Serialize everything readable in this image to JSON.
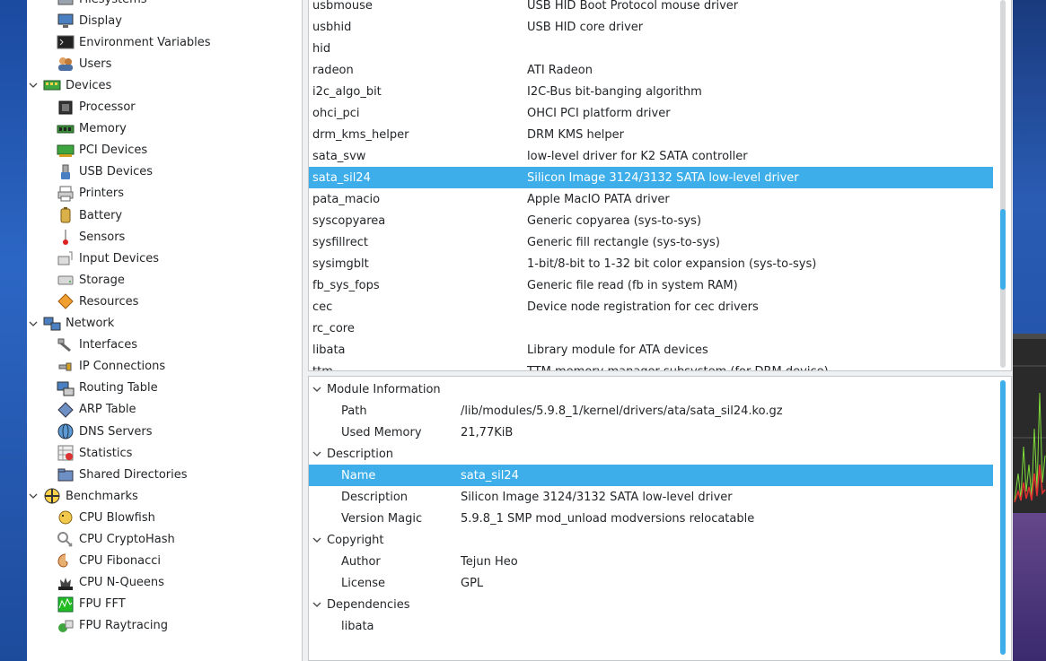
{
  "tree": {
    "items": [
      {
        "label": "Filesystems",
        "indent": 1,
        "icon": "filesystems-icon",
        "expander": ""
      },
      {
        "label": "Display",
        "indent": 1,
        "icon": "display-icon",
        "expander": ""
      },
      {
        "label": "Environment Variables",
        "indent": 1,
        "icon": "terminal-icon",
        "expander": ""
      },
      {
        "label": "Users",
        "indent": 1,
        "icon": "users-icon",
        "expander": ""
      },
      {
        "label": "Devices",
        "indent": 0,
        "icon": "devices-icon",
        "expander": "v"
      },
      {
        "label": "Processor",
        "indent": 1,
        "icon": "processor-icon",
        "expander": ""
      },
      {
        "label": "Memory",
        "indent": 1,
        "icon": "memory-icon",
        "expander": ""
      },
      {
        "label": "PCI Devices",
        "indent": 1,
        "icon": "pci-icon",
        "expander": ""
      },
      {
        "label": "USB Devices",
        "indent": 1,
        "icon": "usb-icon",
        "expander": ""
      },
      {
        "label": "Printers",
        "indent": 1,
        "icon": "printer-icon",
        "expander": ""
      },
      {
        "label": "Battery",
        "indent": 1,
        "icon": "battery-icon",
        "expander": ""
      },
      {
        "label": "Sensors",
        "indent": 1,
        "icon": "thermometer-icon",
        "expander": ""
      },
      {
        "label": "Input Devices",
        "indent": 1,
        "icon": "input-devices-icon",
        "expander": ""
      },
      {
        "label": "Storage",
        "indent": 1,
        "icon": "storage-icon",
        "expander": ""
      },
      {
        "label": "Resources",
        "indent": 1,
        "icon": "resources-icon",
        "expander": ""
      },
      {
        "label": "Network",
        "indent": 0,
        "icon": "network-icon",
        "expander": "v"
      },
      {
        "label": "Interfaces",
        "indent": 1,
        "icon": "interfaces-icon",
        "expander": ""
      },
      {
        "label": "IP Connections",
        "indent": 1,
        "icon": "ip-connections-icon",
        "expander": ""
      },
      {
        "label": "Routing Table",
        "indent": 1,
        "icon": "routing-icon",
        "expander": ""
      },
      {
        "label": "ARP Table",
        "indent": 1,
        "icon": "arp-icon",
        "expander": ""
      },
      {
        "label": "DNS Servers",
        "indent": 1,
        "icon": "dns-icon",
        "expander": ""
      },
      {
        "label": "Statistics",
        "indent": 1,
        "icon": "statistics-icon",
        "expander": ""
      },
      {
        "label": "Shared Directories",
        "indent": 1,
        "icon": "shared-dirs-icon",
        "expander": ""
      },
      {
        "label": "Benchmarks",
        "indent": 0,
        "icon": "benchmarks-icon",
        "expander": "v"
      },
      {
        "label": "CPU Blowfish",
        "indent": 1,
        "icon": "blowfish-icon",
        "expander": ""
      },
      {
        "label": "CPU CryptoHash",
        "indent": 1,
        "icon": "cryptohash-icon",
        "expander": ""
      },
      {
        "label": "CPU Fibonacci",
        "indent": 1,
        "icon": "fibonacci-icon",
        "expander": ""
      },
      {
        "label": "CPU N-Queens",
        "indent": 1,
        "icon": "nqueens-icon",
        "expander": ""
      },
      {
        "label": "FPU FFT",
        "indent": 1,
        "icon": "fft-icon",
        "expander": ""
      },
      {
        "label": "FPU Raytracing",
        "indent": 1,
        "icon": "raytracing-icon",
        "expander": ""
      }
    ]
  },
  "modules": {
    "rows": [
      {
        "name": "usbmouse",
        "desc": "USB HID Boot Protocol mouse driver"
      },
      {
        "name": "usbhid",
        "desc": "USB HID core driver"
      },
      {
        "name": "hid",
        "desc": ""
      },
      {
        "name": "radeon",
        "desc": "ATI Radeon"
      },
      {
        "name": "i2c_algo_bit",
        "desc": "I2C-Bus bit-banging algorithm"
      },
      {
        "name": "ohci_pci",
        "desc": "OHCI PCI platform driver"
      },
      {
        "name": "drm_kms_helper",
        "desc": "DRM KMS helper"
      },
      {
        "name": "sata_svw",
        "desc": "low-level driver for K2 SATA controller"
      },
      {
        "name": "sata_sil24",
        "desc": "Silicon Image 3124/3132 SATA low-level driver",
        "selected": true
      },
      {
        "name": "pata_macio",
        "desc": "Apple MacIO PATA driver"
      },
      {
        "name": "syscopyarea",
        "desc": "Generic copyarea (sys-to-sys)"
      },
      {
        "name": "sysfillrect",
        "desc": "Generic fill rectangle (sys-to-sys)"
      },
      {
        "name": "sysimgblt",
        "desc": "1-bit/8-bit to 1-32 bit color expansion (sys-to-sys)"
      },
      {
        "name": "fb_sys_fops",
        "desc": "Generic file read (fb in system RAM)"
      },
      {
        "name": "cec",
        "desc": "Device node registration for cec drivers"
      },
      {
        "name": "rc_core",
        "desc": ""
      },
      {
        "name": "libata",
        "desc": "Library module for ATA devices"
      },
      {
        "name": "ttm",
        "desc": "TTM memory manager subsystem (for DRM device)"
      }
    ]
  },
  "info": {
    "rows": [
      {
        "type": "section",
        "text": "Module Information"
      },
      {
        "type": "pair",
        "key": "Path",
        "val": "/lib/modules/5.9.8_1/kernel/drivers/ata/sata_sil24.ko.gz"
      },
      {
        "type": "pair",
        "key": "Used Memory",
        "val": "21,77KiB"
      },
      {
        "type": "section",
        "text": "Description"
      },
      {
        "type": "pair",
        "key": "Name",
        "val": "sata_sil24",
        "selected": true
      },
      {
        "type": "pair",
        "key": "Description",
        "val": "Silicon Image 3124/3132 SATA low-level driver"
      },
      {
        "type": "pair",
        "key": "Version Magic",
        "val": "5.9.8_1 SMP mod_unload modversions relocatable"
      },
      {
        "type": "section",
        "text": "Copyright"
      },
      {
        "type": "pair",
        "key": "Author",
        "val": "Tejun Heo"
      },
      {
        "type": "pair",
        "key": "License",
        "val": "GPL"
      },
      {
        "type": "section",
        "text": "Dependencies"
      },
      {
        "type": "pair",
        "key": "libata",
        "val": ""
      }
    ]
  },
  "colors": {
    "selection": "#3daee9",
    "accent": "#3daee9"
  }
}
